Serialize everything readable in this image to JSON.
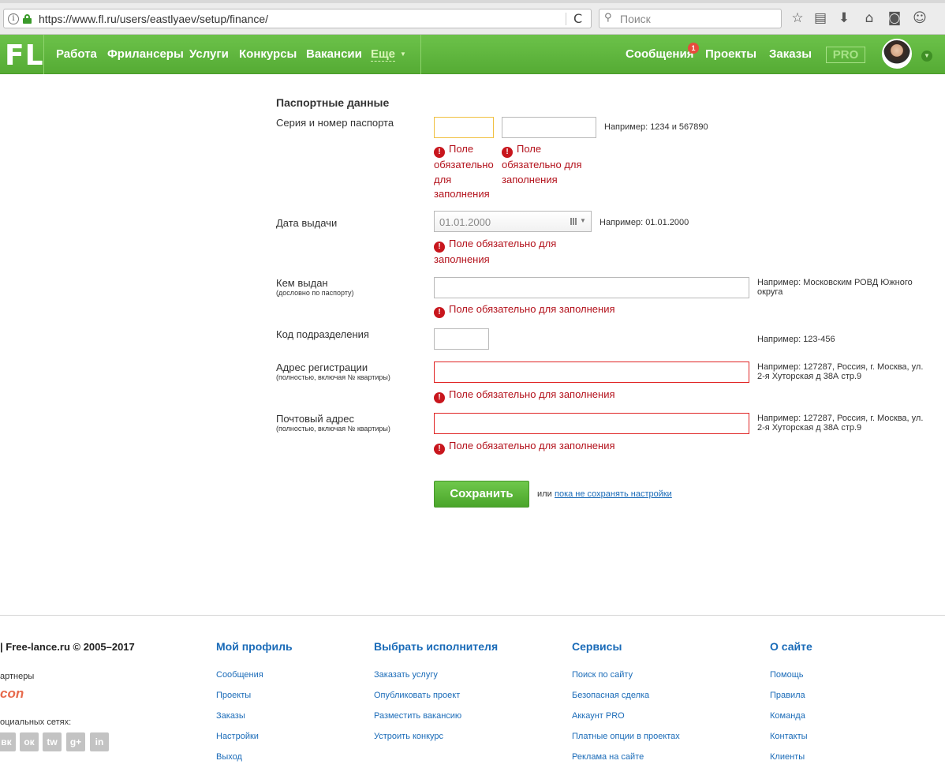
{
  "browser": {
    "url": "https://www.fl.ru/users/eastlyaev/setup/finance/",
    "search_placeholder": "Поиск",
    "reload_glyph": "C"
  },
  "site": {
    "logo": "FL",
    "nav": [
      "Работа",
      "Фрилансеры",
      "Услуги",
      "Конкурсы",
      "Вакансии"
    ],
    "nav_more": "Еще",
    "right_nav": {
      "messages": "Сообщения",
      "messages_badge": "1",
      "projects": "Проекты",
      "orders": "Заказы",
      "pro": "PRO"
    }
  },
  "form": {
    "section_title": "Паспортные данные",
    "required_error": "Поле обязательно для заполнения",
    "passport": {
      "label": "Серия и номер паспорта",
      "hint": "Например: 1234 и 567890",
      "series_error": [
        "Поле",
        "обязательно",
        "для",
        "заполнения"
      ],
      "number_error": [
        "Поле",
        "обязательно для",
        "заполнения"
      ]
    },
    "issue_date": {
      "label": "Дата выдачи",
      "value": "01.01.2000",
      "hint": "Например: 01.01.2000",
      "error": [
        "Поле обязательно для",
        "заполнения"
      ]
    },
    "issued_by": {
      "label": "Кем выдан",
      "sublabel": "(дословно по паспорту)",
      "hint": [
        "Например: Московским РОВД Южного",
        "округа"
      ]
    },
    "dept_code": {
      "label": "Код подразделения",
      "hint": "Например: 123-456"
    },
    "reg_address": {
      "label": "Адрес регистрации",
      "sublabel": "(полностью, включая № квартиры)",
      "hint": [
        "Например: 127287, Россия, г. Москва, ул.",
        "2-я Хуторская д 38А стр.9"
      ]
    },
    "postal_address": {
      "label": "Почтовый адрес",
      "sublabel": "(полностью, включая № квартиры)",
      "hint": [
        "Например: 127287, Россия, г. Москва, ул.",
        "2-я Хуторская д 38А стр.9"
      ]
    },
    "save_label": "Сохранить",
    "or_text": "или",
    "skip_link": "пока не сохранять настройки"
  },
  "footer": {
    "copyright": "| Free-lance.ru © 2005–2017",
    "partners_label": "артнеры",
    "partner_logo": "con",
    "social_label": "оциальных сетях:",
    "social": [
      "вк",
      "ок",
      "tw",
      "g+",
      "in"
    ],
    "columns": [
      {
        "title": "Мой профиль",
        "links": [
          "Сообщения",
          "Проекты",
          "Заказы",
          "Настройки",
          "Выход"
        ]
      },
      {
        "title": "Выбрать исполнителя",
        "links": [
          "Заказать услугу",
          "Опубликовать проект",
          "Разместить вакансию",
          "Устроить конкурс"
        ]
      },
      {
        "title": "Сервисы",
        "links": [
          "Поиск по сайту",
          "Безопасная сделка",
          "Аккаунт PRO",
          "Платные опции в проектах",
          "Реклама на сайте"
        ]
      },
      {
        "title": "О сайте",
        "links": [
          "Помощь",
          "Правила",
          "Команда",
          "Контакты",
          "Клиенты"
        ]
      }
    ]
  }
}
